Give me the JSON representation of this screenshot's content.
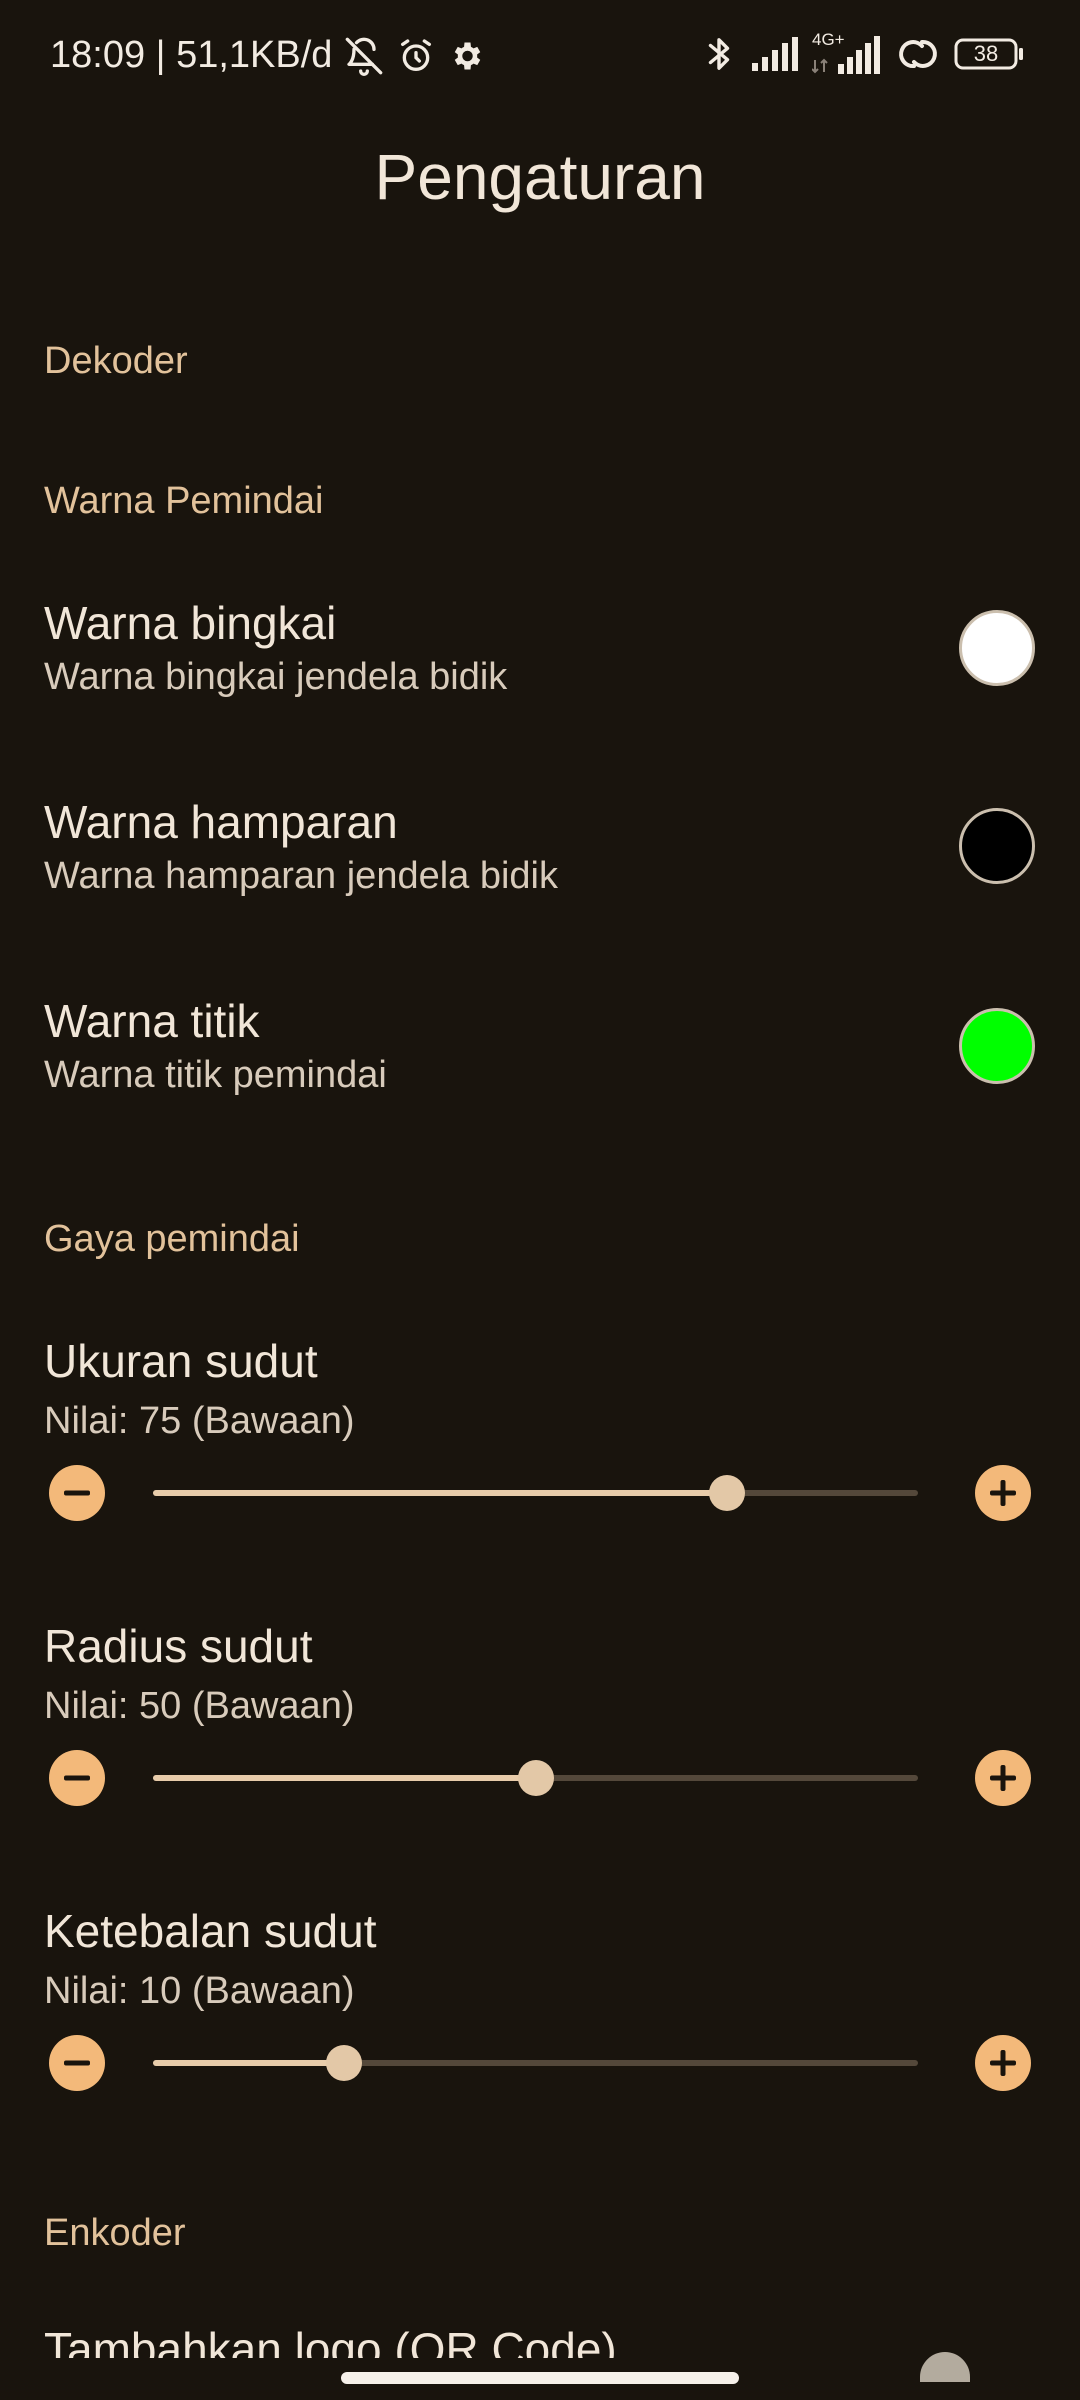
{
  "status_bar": {
    "time_speed": "18:09 | 51,1KB/d",
    "network_label": "4G+",
    "battery": "38"
  },
  "title": "Pengaturan",
  "sections": {
    "decoder": "Dekoder",
    "scanner_color": "Warna Pemindai",
    "scanner_style": "Gaya pemindai",
    "encoder": "Enkoder"
  },
  "color_prefs": [
    {
      "title": "Warna bingkai",
      "subtitle": "Warna bingkai jendela bidik",
      "color": "#ffffff"
    },
    {
      "title": "Warna hamparan",
      "subtitle": "Warna hamparan jendela bidik",
      "color": "#000000"
    },
    {
      "title": "Warna titik",
      "subtitle": "Warna titik pemindai",
      "color": "#00ff00"
    }
  ],
  "sliders": [
    {
      "title": "Ukuran sudut",
      "value_text": "Nilai: 75  (Bawaan)",
      "value": 75,
      "fraction": 0.75
    },
    {
      "title": "Radius sudut",
      "value_text": "Nilai: 50  (Bawaan)",
      "value": 50,
      "fraction": 0.5
    },
    {
      "title": "Ketebalan sudut",
      "value_text": "Nilai: 10  (Bawaan)",
      "value": 10,
      "fraction": 0.25
    }
  ],
  "encoder_item": {
    "title": "Tambahkan logo (QR Code)"
  },
  "colors": {
    "accent": "#f3b97a",
    "section_header": "#e2c29b",
    "background": "#19140d"
  }
}
